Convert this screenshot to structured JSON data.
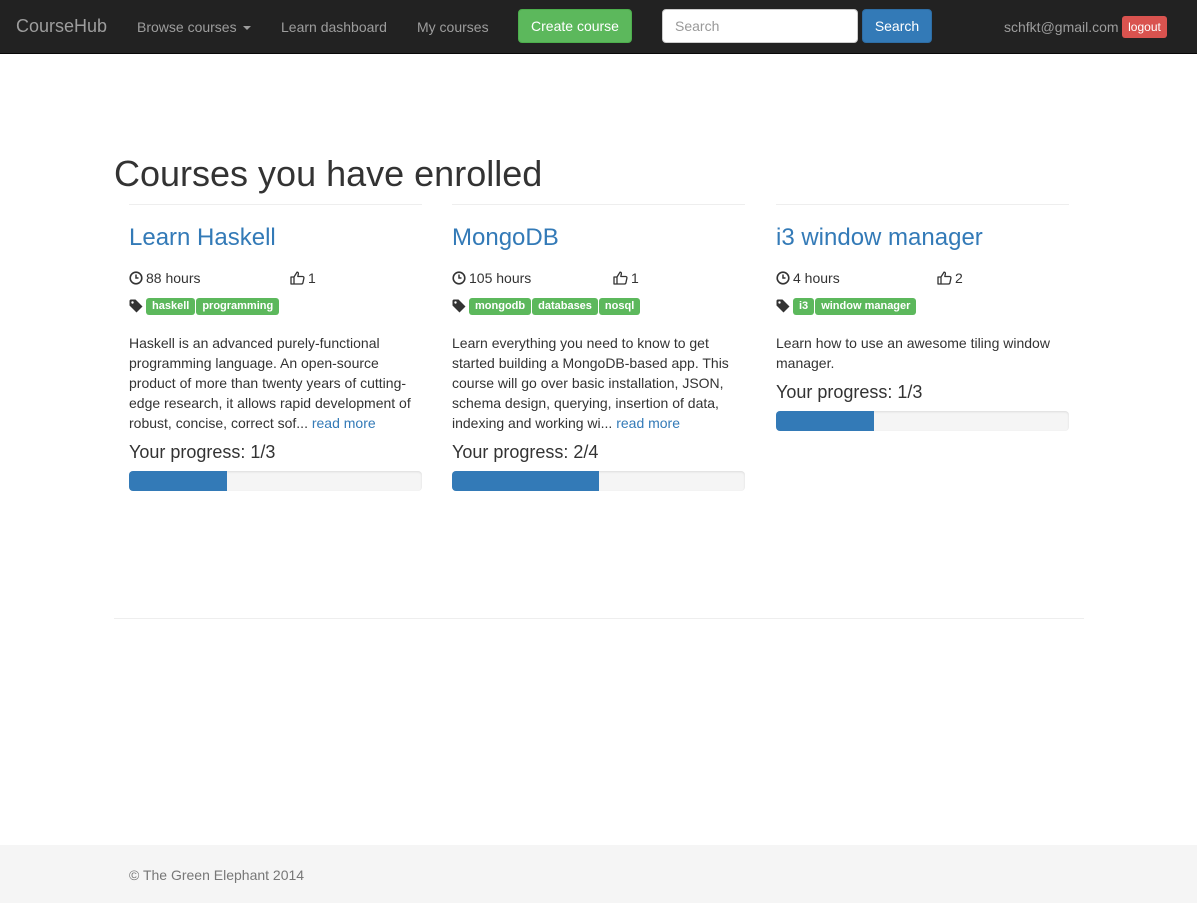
{
  "navbar": {
    "brand": "CourseHub",
    "browse_label": "Browse courses",
    "learn_dashboard_label": "Learn dashboard",
    "my_courses_label": "My courses",
    "create_course_label": "Create course",
    "search_placeholder": "Search",
    "search_button_label": "Search",
    "user_email": "schfkt@gmail.com",
    "logout_label": "logout"
  },
  "main": {
    "title": "Courses you have enrolled",
    "courses": [
      {
        "title": "Learn Haskell",
        "hours": "88 hours",
        "likes": "1",
        "tags": [
          "haskell",
          "programming"
        ],
        "description": "Haskell is an advanced purely-functional programming language. An open-source product of more than twenty years of cutting-edge research, it allows rapid development of robust, concise, correct sof...",
        "read_more": "read more",
        "progress_label": "Your progress: 1/3",
        "progress_fraction": 0.3333
      },
      {
        "title": "MongoDB",
        "hours": "105 hours",
        "likes": "1",
        "tags": [
          "mongodb",
          "databases",
          "nosql"
        ],
        "description": "Learn everything you need to know to get started building a MongoDB-based app. This course will go over basic installation, JSON, schema design, querying, insertion of data, indexing and working wi...",
        "read_more": "read more",
        "progress_label": "Your progress: 2/4",
        "progress_fraction": 0.5
      },
      {
        "title": "i3 window manager",
        "hours": "4 hours",
        "likes": "2",
        "tags": [
          "i3",
          "window manager"
        ],
        "description": "Learn how to use an awesome tiling window manager.",
        "read_more": "",
        "progress_label": "Your progress: 1/3",
        "progress_fraction": 0.3333
      }
    ]
  },
  "footer": {
    "text": "© The Green Elephant 2014"
  },
  "colors": {
    "navbar_bg": "#222222",
    "link_blue": "#337ab7",
    "tag_green": "#5cb85c",
    "logout_red": "#d9534f",
    "progress_bar": "#337ab7"
  },
  "icons": {
    "hours": "clock-icon",
    "likes": "thumbs-up-icon",
    "tags": "tag-icon"
  }
}
